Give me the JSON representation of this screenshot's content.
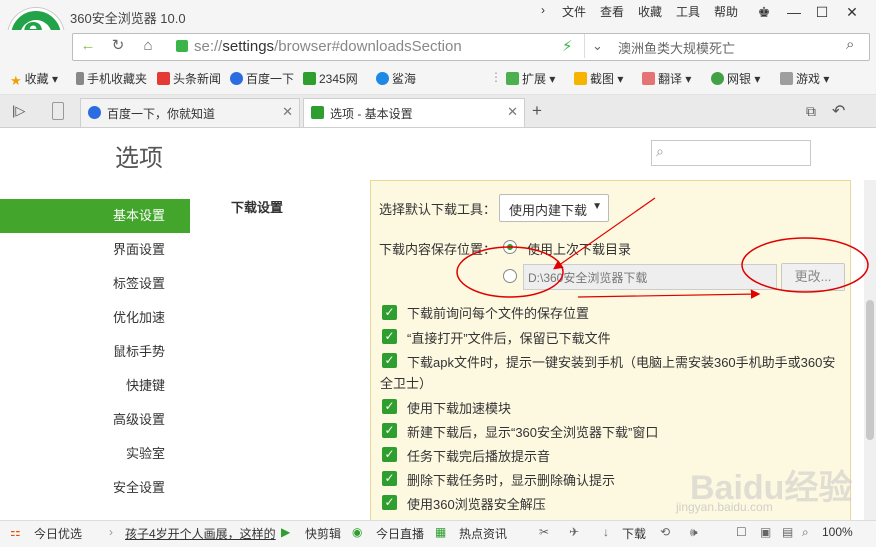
{
  "app": {
    "title": "360安全浏览器 10.0"
  },
  "menu": {
    "file": "文件",
    "view": "查看",
    "favorites": "收藏",
    "tools": "工具",
    "help": "帮助"
  },
  "address": {
    "url_prefix": "se://",
    "url_host": "settings",
    "url_rest": "/browser#downloadsSection",
    "search_text": "澳洲鱼类大规模死亡"
  },
  "bookmarks": {
    "items": [
      "收藏",
      "手机收藏夹",
      "头条新闻",
      "百度一下",
      "2345网",
      "鲨海"
    ],
    "tools": [
      "扩展",
      "截图",
      "翻译",
      "网银",
      "游戏"
    ]
  },
  "tabs": [
    {
      "label": "百度一下，你就知道"
    },
    {
      "label": "选项 - 基本设置"
    }
  ],
  "page": {
    "title": "选项"
  },
  "sidebar": {
    "items": [
      "基本设置",
      "界面设置",
      "标签设置",
      "优化加速",
      "鼠标手势",
      "快捷键",
      "高级设置",
      "实验室",
      "安全设置"
    ]
  },
  "download": {
    "section_title": "下载设置",
    "tool_label": "选择默认下载工具：",
    "tool_value": "使用内建下载",
    "location_label": "下载内容保存位置：",
    "option_last": "使用上次下载目录",
    "path_value": "D:\\360安全浏览器下载",
    "change_btn": "更改...",
    "checkboxes": [
      "下载前询问每个文件的保存位置",
      "“直接打开”文件后，保留已下载文件",
      "下载apk文件时，提示一键安装到手机（电脑上需安装360手机助手或360安",
      "全卫士）",
      "使用下载加速模块",
      "新建下载后，显示“360安全浏览器下载”窗口",
      "任务下载完后播放提示音",
      "删除下载任务时，显示删除确认提示",
      "使用360浏览器安全解压"
    ]
  },
  "statusbar": {
    "today": "今日优选",
    "news": "孩子4岁开个人画展，这样的",
    "clip": "快剪辑",
    "live": "今日直播",
    "hot": "热点资讯",
    "download": "下载",
    "zoom": "100%"
  },
  "watermark": {
    "brand": "Baidu经验",
    "url": "jingyan.baidu.com"
  },
  "colors": {
    "accent": "#43a52b",
    "annotation": "#e00000"
  }
}
